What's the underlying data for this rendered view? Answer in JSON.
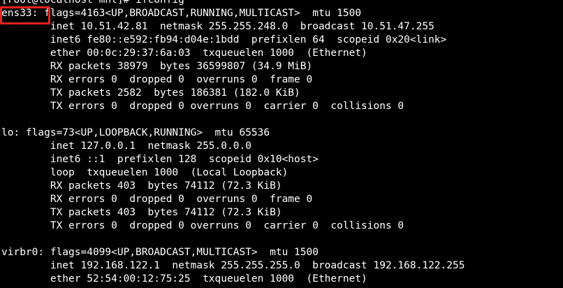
{
  "terminal": {
    "lines": [
      "[root@localhost mnt]# ifconfig",
      "ens33: flags=4163<UP,BROADCAST,RUNNING,MULTICAST>  mtu 1500",
      "        inet 10.51.42.81  netmask 255.255.248.0  broadcast 10.51.47.255",
      "        inet6 fe80::e592:fb94:d04e:1bdd  prefixlen 64  scopeid 0x20<link>",
      "        ether 00:0c:29:37:6a:03  txqueuelen 1000  (Ethernet)",
      "        RX packets 38979  bytes 36599807 (34.9 MiB)",
      "        RX errors 0  dropped 0  overruns 0  frame 0",
      "        TX packets 2582  bytes 186381 (182.0 KiB)",
      "        TX errors 0  dropped 0 overruns 0  carrier 0  collisions 0",
      "",
      "lo: flags=73<UP,LOOPBACK,RUNNING>  mtu 65536",
      "        inet 127.0.0.1  netmask 255.0.0.0",
      "        inet6 ::1  prefixlen 128  scopeid 0x10<host>",
      "        loop  txqueuelen 1000  (Local Loopback)",
      "        RX packets 403  bytes 74112 (72.3 KiB)",
      "        RX errors 0  dropped 0  overruns 0  frame 0",
      "        TX packets 403  bytes 74112 (72.3 KiB)",
      "        TX errors 0  dropped 0 overruns 0  carrier 0  collisions 0",
      "",
      "virbr0: flags=4099<UP,BROADCAST,MULTICAST>  mtu 1500",
      "        inet 192.168.122.1  netmask 255.255.255.0  broadcast 192.168.122.255",
      "        ether 52:54:00:12:75:25  txqueuelen 1000  (Ethernet)"
    ]
  },
  "colors": {
    "background": "#000000",
    "text": "#ffffff",
    "highlight": "#e8231d"
  }
}
